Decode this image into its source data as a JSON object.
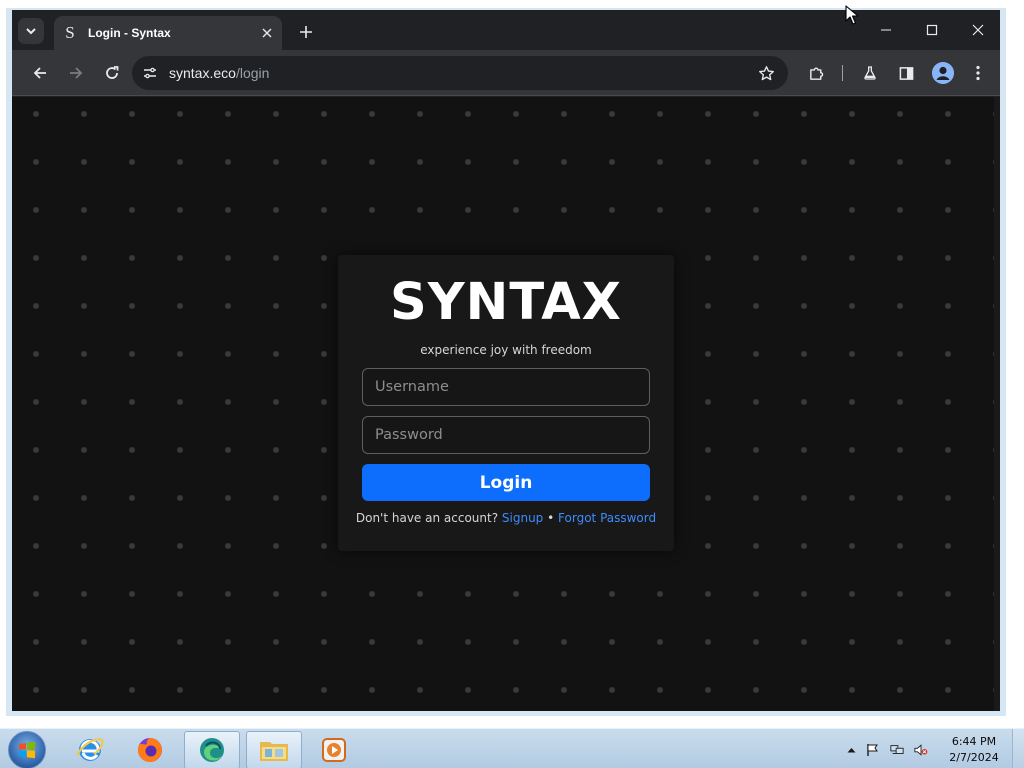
{
  "browser": {
    "tab_title": "Login - Syntax",
    "tab_favicon": "S",
    "url_host": "syntax.eco",
    "url_path": "/login"
  },
  "page": {
    "brand": "SYNTAX",
    "tagline": "experience joy with freedom",
    "username_placeholder": "Username",
    "password_placeholder": "Password",
    "login_label": "Login",
    "no_account_text": "Don't have an account?",
    "signup_label": "Signup",
    "separator": "•",
    "forgot_label": "Forgot Password"
  },
  "taskbar": {
    "time": "6:44 PM",
    "date": "2/7/2024"
  },
  "icons": {
    "tab_search": "chevron-down-icon",
    "tab_close": "close-icon",
    "new_tab": "plus-icon",
    "back": "arrow-left-icon",
    "forward": "arrow-right-icon",
    "reload": "reload-icon",
    "site_info": "tune-icon",
    "bookmark": "star-icon",
    "extensions": "puzzle-icon",
    "labs": "flask-icon",
    "side_panel": "side-panel-icon",
    "profile": "profile-icon",
    "menu": "kebab-menu-icon"
  },
  "colors": {
    "page_bg": "#121212",
    "card_bg": "#181818",
    "button_blue": "#0d6efd",
    "link_blue": "#3d8bfd",
    "browser_dark": "#202124",
    "toolbar": "#35363a"
  }
}
